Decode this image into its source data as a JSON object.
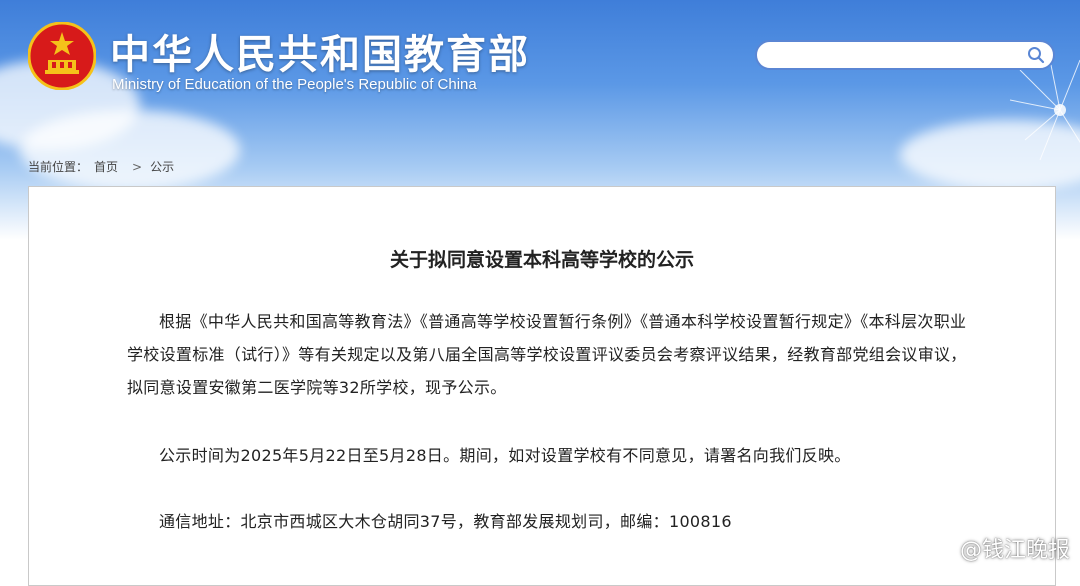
{
  "header": {
    "title_cn": "中华人民共和国教育部",
    "title_en": "Ministry of Education of the People's Republic of China",
    "emblem_icon": "national-emblem-icon"
  },
  "search": {
    "value": "",
    "placeholder": "",
    "icon": "search-icon"
  },
  "breadcrumb": {
    "label": "当前位置：",
    "home": "首页",
    "separator": ">",
    "current": "公示"
  },
  "article": {
    "title": "关于拟同意设置本科高等学校的公示",
    "paragraphs": [
      "根据《中华人民共和国高等教育法》《普通高等学校设置暂行条例》《普通本科学校设置暂行规定》《本科层次职业学校设置标准（试行）》等有关规定以及第八届全国高等学校设置评议委员会考察评议结果，经教育部党组会议审议，拟同意设置安徽第二医学院等32所学校，现予公示。",
      "公示时间为2025年5月22日至5月28日。期间，如对设置学校有不同意见，请署名向我们反映。",
      "通信地址：北京市西城区大木仓胡同37号，教育部发展规划司，邮编：100816"
    ]
  },
  "watermark": {
    "text": "@钱江晚报",
    "icon": "weibo-icon"
  },
  "colors": {
    "banner_top": "#3f7ed9",
    "banner_mid": "#5b98e6",
    "search_border": "#5a86d4",
    "emblem_red": "#d71a1a",
    "emblem_gold": "#f5c21a"
  }
}
